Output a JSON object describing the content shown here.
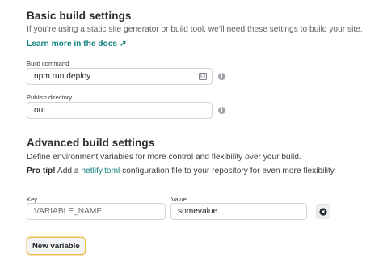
{
  "basic": {
    "heading": "Basic build settings",
    "description": "If you’re using a static site generator or build tool, we’ll need these settings to build your site.",
    "docs_link": "Learn more in the docs",
    "docs_arrow": "↗"
  },
  "build_command": {
    "label": "Build command",
    "value": "npm run deploy",
    "icon": "card-icon"
  },
  "publish_directory": {
    "label": "Publish directory",
    "value": "out"
  },
  "info_icon": "info-icon",
  "advanced": {
    "heading": "Advanced build settings",
    "description": "Define environment variables for more control and flexibility over your build.",
    "pro_tip_label": "Pro tip!",
    "pro_tip_pre": " Add a ",
    "pro_tip_link": "netlify.toml",
    "pro_tip_post": " configuration file to your repository for even more flexibility."
  },
  "env": {
    "key_label": "Key",
    "key_placeholder": "VARIABLE_NAME",
    "value_label": "Value",
    "value_value": "somevalue",
    "delete_icon": "close-circle-icon"
  },
  "new_variable_label": "New variable",
  "colors": {
    "link": "#15847d",
    "focus_ring": "#e9b949",
    "border": "#d3d6da"
  }
}
